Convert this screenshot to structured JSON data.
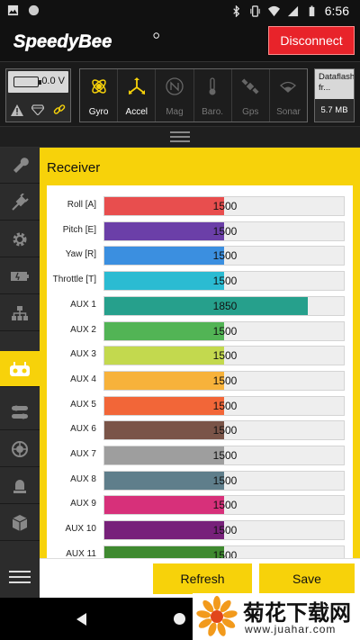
{
  "status_bar": {
    "time": "6:56"
  },
  "app_bar": {
    "brand": "SpeedyBee",
    "disconnect_label": "Disconnect"
  },
  "battery": {
    "voltage": "0.0 V"
  },
  "sensors": [
    {
      "label": "Gyro",
      "active": true
    },
    {
      "label": "Accel",
      "active": true
    },
    {
      "label": "Mag",
      "active": false
    },
    {
      "label": "Baro.",
      "active": false
    },
    {
      "label": "Gps",
      "active": false
    },
    {
      "label": "Sonar",
      "active": false
    }
  ],
  "dataflash": {
    "label": "Dataflash fr...",
    "size": "5.7 MB"
  },
  "receiver": {
    "title": "Receiver",
    "channels": [
      {
        "label": "Roll [A]",
        "value": 1500,
        "color": "#e84e4e"
      },
      {
        "label": "Pitch [E]",
        "value": 1500,
        "color": "#6b3fa8"
      },
      {
        "label": "Yaw [R]",
        "value": 1500,
        "color": "#3b8fe0"
      },
      {
        "label": "Throttle [T]",
        "value": 1500,
        "color": "#2bbbd2"
      },
      {
        "label": "AUX 1",
        "value": 1850,
        "color": "#26a08c"
      },
      {
        "label": "AUX 2",
        "value": 1500,
        "color": "#52b455"
      },
      {
        "label": "AUX 3",
        "value": 1500,
        "color": "#c3d94e"
      },
      {
        "label": "AUX 4",
        "value": 1500,
        "color": "#f7b23b"
      },
      {
        "label": "AUX 5",
        "value": 1500,
        "color": "#f26638"
      },
      {
        "label": "AUX 6",
        "value": 1500,
        "color": "#7a5448"
      },
      {
        "label": "AUX 7",
        "value": 1500,
        "color": "#9e9e9e"
      },
      {
        "label": "AUX 8",
        "value": 1500,
        "color": "#5f7e8b"
      },
      {
        "label": "AUX 9",
        "value": 1500,
        "color": "#d7307a"
      },
      {
        "label": "AUX 10",
        "value": 1500,
        "color": "#77217a"
      },
      {
        "label": "AUX 11",
        "value": 1500,
        "color": "#3f8a30"
      }
    ]
  },
  "actions": {
    "refresh_label": "Refresh",
    "save_label": "Save"
  },
  "watermark": {
    "title": "菊花下载网",
    "url": "www.juahar.com"
  },
  "colors": {
    "accent": "#f7d20a",
    "danger": "#e8232a"
  }
}
